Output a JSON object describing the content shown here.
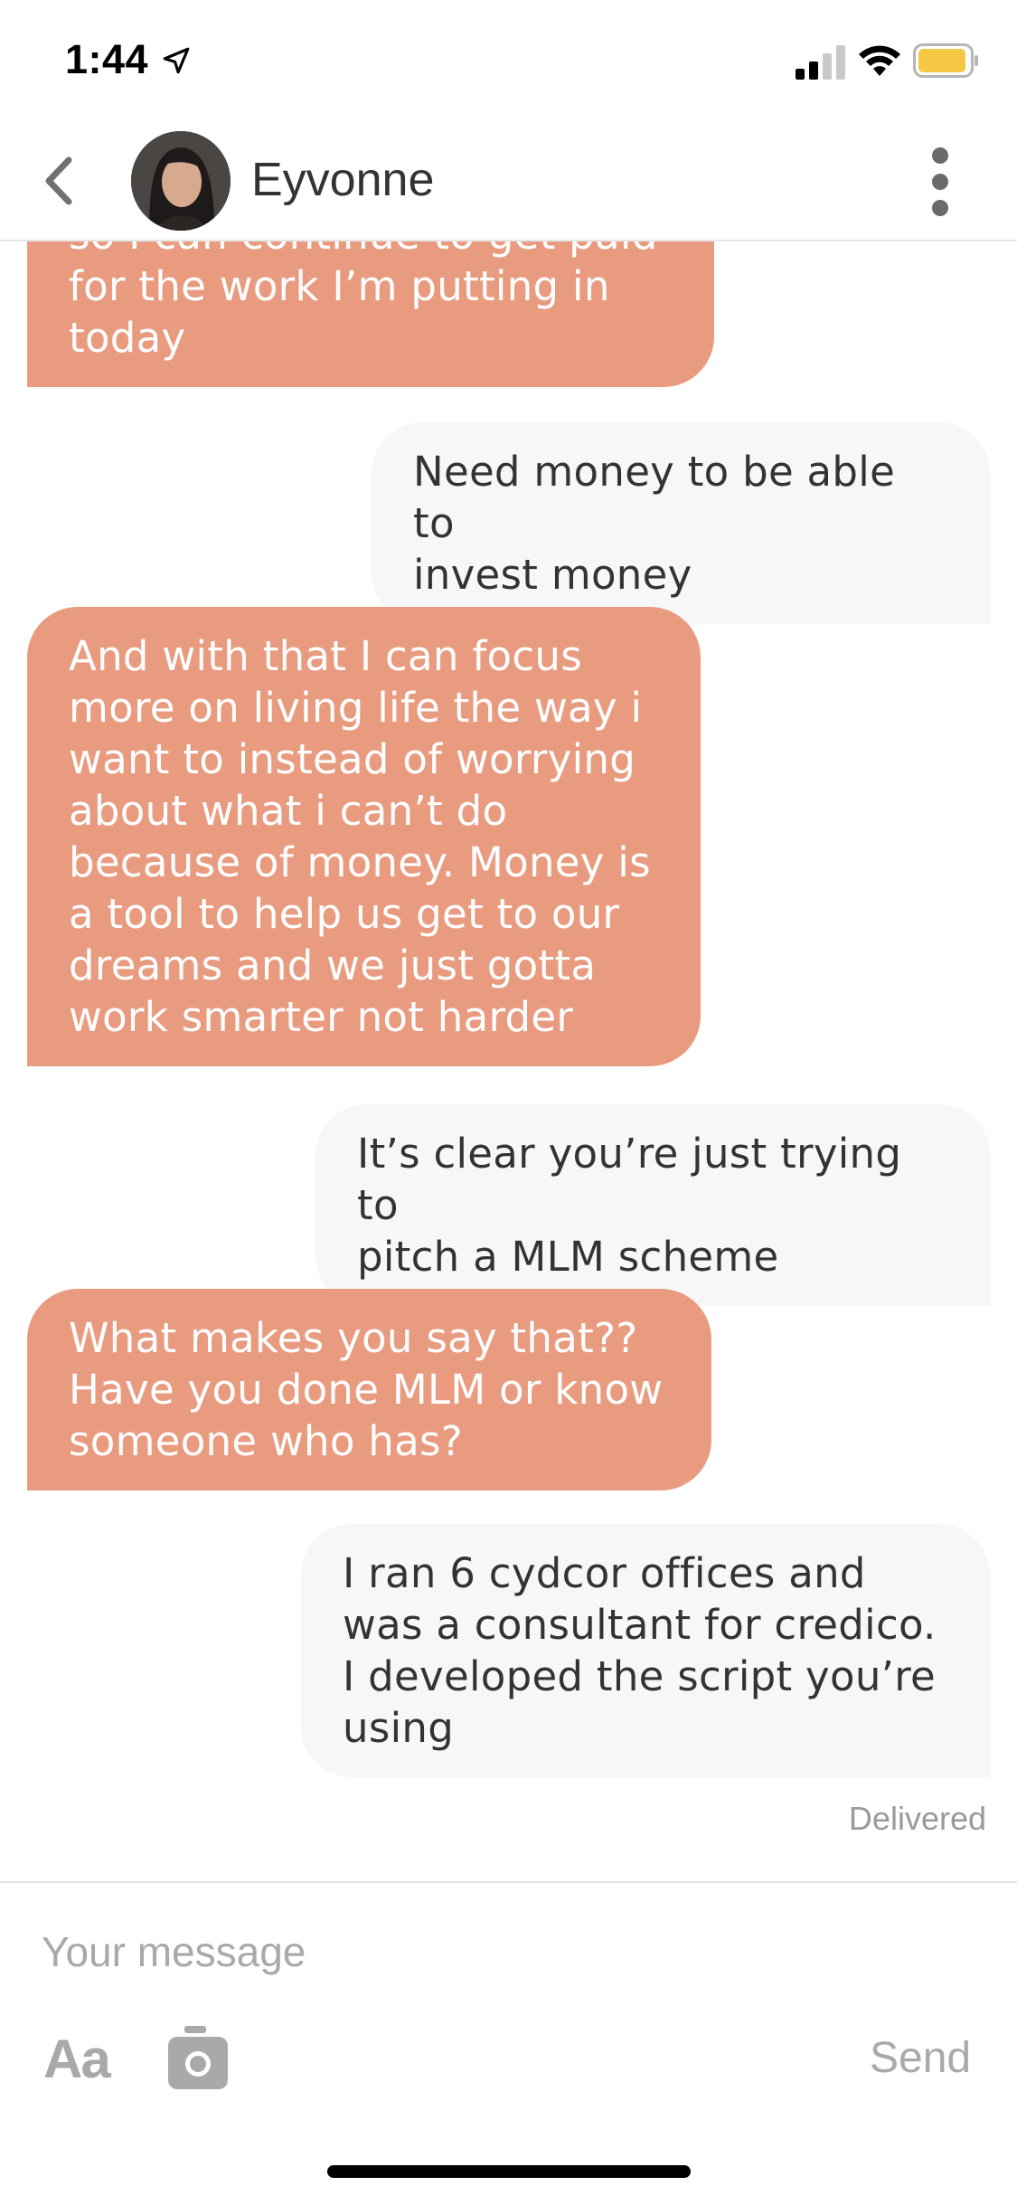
{
  "status_bar": {
    "time": "1:44",
    "icons": [
      "location-arrow-icon",
      "cellular-signal-icon",
      "wifi-icon",
      "battery-icon"
    ],
    "battery_color": "#f5c945"
  },
  "header": {
    "contact_name": "Eyvonne",
    "back_icon": "chevron-left-icon",
    "more_icon": "more-vertical-icon"
  },
  "messages": [
    {
      "direction": "in",
      "text": "so I can continue to get paid\nfor the work I’m putting in\ntoday"
    },
    {
      "direction": "out",
      "text": "Need money to be able to\ninvest money"
    },
    {
      "direction": "in",
      "text": "And with that I can focus\nmore on living life the way i\nwant to instead of worrying\nabout what i can’t do\nbecause of money. Money is\na tool to help us get to our\ndreams and we just gotta\nwork smarter not harder"
    },
    {
      "direction": "out",
      "text": "It’s clear you’re just trying to\npitch a MLM scheme"
    },
    {
      "direction": "in",
      "text": "What makes you say that??\nHave you done MLM or know\nsomeone who has?"
    },
    {
      "direction": "out",
      "text": "I ran 6 cydcor offices and\nwas a consultant for credico.\nI developed the script you’re\nusing"
    }
  ],
  "delivered_label": "Delivered",
  "composer": {
    "placeholder": "Your message",
    "value": "",
    "font_button_label": "Aa",
    "camera_icon": "camera-icon",
    "send_label": "Send"
  },
  "colors": {
    "incoming_bubble": "#e99b80",
    "outgoing_bubble": "#f7f7f7",
    "muted_text": "#a9a9a9"
  }
}
